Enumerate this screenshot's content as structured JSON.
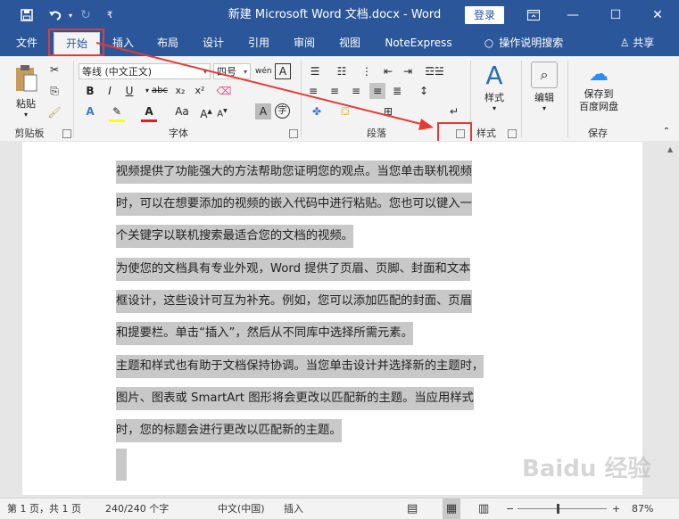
{
  "window": {
    "title": "新建 Microsoft Word 文档.docx - Word",
    "login_label": "登录",
    "save_icon": "save-icon",
    "undo_icon": "undo-icon",
    "redo_icon": "redo-icon"
  },
  "tabs": [
    {
      "label": "文件"
    },
    {
      "label": "开始"
    },
    {
      "label": "插入"
    },
    {
      "label": "布局"
    },
    {
      "label": "设计"
    },
    {
      "label": "引用"
    },
    {
      "label": "审阅"
    },
    {
      "label": "视图"
    },
    {
      "label": "NoteExpress"
    },
    {
      "label": "操作说明搜索"
    },
    {
      "label": "共享"
    }
  ],
  "ribbon": {
    "clipboard": {
      "paste_label": "粘贴",
      "group_label": "剪贴板"
    },
    "font": {
      "font_name": "等线 (中文正文)",
      "font_size": "四号",
      "group_label": "字体",
      "bold": "B",
      "italic": "I",
      "underline": "U",
      "strike": "abc",
      "sub": "x₂",
      "sup": "x²",
      "font_size_label": "Aa",
      "wen": "wén",
      "A_box": "A"
    },
    "paragraph": {
      "group_label": "段落"
    },
    "styles": {
      "label": "样式",
      "group_label": "样式"
    },
    "editing": {
      "label": "编辑"
    },
    "save": {
      "label_line1": "保存到",
      "label_line2": "百度网盘",
      "group_label": "保存"
    }
  },
  "document": {
    "paragraphs": [
      {
        "lines": [
          "视频提供了功能强大的方法帮助您证明您的观点。当您单击联机视频",
          "时，可以在想要添加的视频的嵌入代码中进行粘贴。您也可以键入一",
          "个关键字以联机搜索最适合您的文档的视频。"
        ]
      },
      {
        "lines": [
          "为使您的文档具有专业外观，Word 提供了页眉、页脚、封面和文本",
          "框设计，这些设计可互为补充。例如，您可以添加匹配的封面、页眉",
          "和提要栏。单击“插入”，然后从不同库中选择所需元素。"
        ]
      },
      {
        "lines": [
          "主题和样式也有助于文档保持协调。当您单击设计并选择新的主题时，",
          "图片、图表或 SmartArt 图形将会更改以匹配新的主题。当应用样式",
          "时，您的标题会进行更改以匹配新的主题。"
        ]
      }
    ]
  },
  "statusbar": {
    "page": "第 1 页，共 1 页",
    "words": "240/240 个字",
    "language": "中文(中国)",
    "mode": "插入",
    "zoom": "87%"
  },
  "watermark": "Baidu 经验"
}
